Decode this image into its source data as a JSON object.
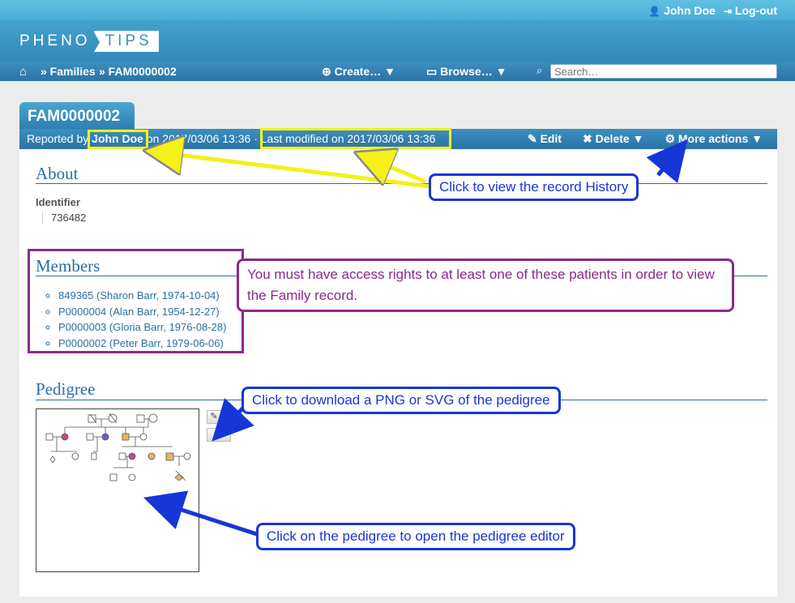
{
  "header": {
    "user_name": "John Doe",
    "logout_label": "Log-out",
    "logo_left": "PHENO",
    "logo_right": "TIPS"
  },
  "nav": {
    "breadcrumb_1": "» Families",
    "breadcrumb_2": "» FAM0000002",
    "create_label": "Create… ▼",
    "browse_label": "Browse… ▼",
    "search_placeholder": "Search…"
  },
  "record": {
    "title": "FAM0000002",
    "reported_by_prefix": "Reported by",
    "reported_by_user": "John Doe",
    "reported_on": "on 2017/03/06 13:36",
    "separator": "·",
    "last_modified": "Last modified on 2017/03/06 13:36",
    "edit_label": "Edit",
    "delete_label": "Delete ▼",
    "more_actions_label": "More actions ▼"
  },
  "about": {
    "title": "About",
    "identifier_label": "Identifier",
    "identifier_value": "736482"
  },
  "members": {
    "title": "Members",
    "items": [
      "849365 (Sharon Barr, 1974-10-04)",
      "P0000004 (Alan Barr, 1954-12-27)",
      "P0000003 (Gloria Barr, 1976-08-28)",
      "P0000002 (Peter Barr, 1979-06-06)"
    ]
  },
  "pedigree": {
    "title": "Pedigree"
  },
  "annotations": {
    "history": "Click to view the record History",
    "access": "You must have access rights to at least one of these patients in order to view the Family record.",
    "download": "Click to download a PNG or SVG of the pedigree",
    "editor": "Click on the pedigree to open the pedigree editor"
  }
}
